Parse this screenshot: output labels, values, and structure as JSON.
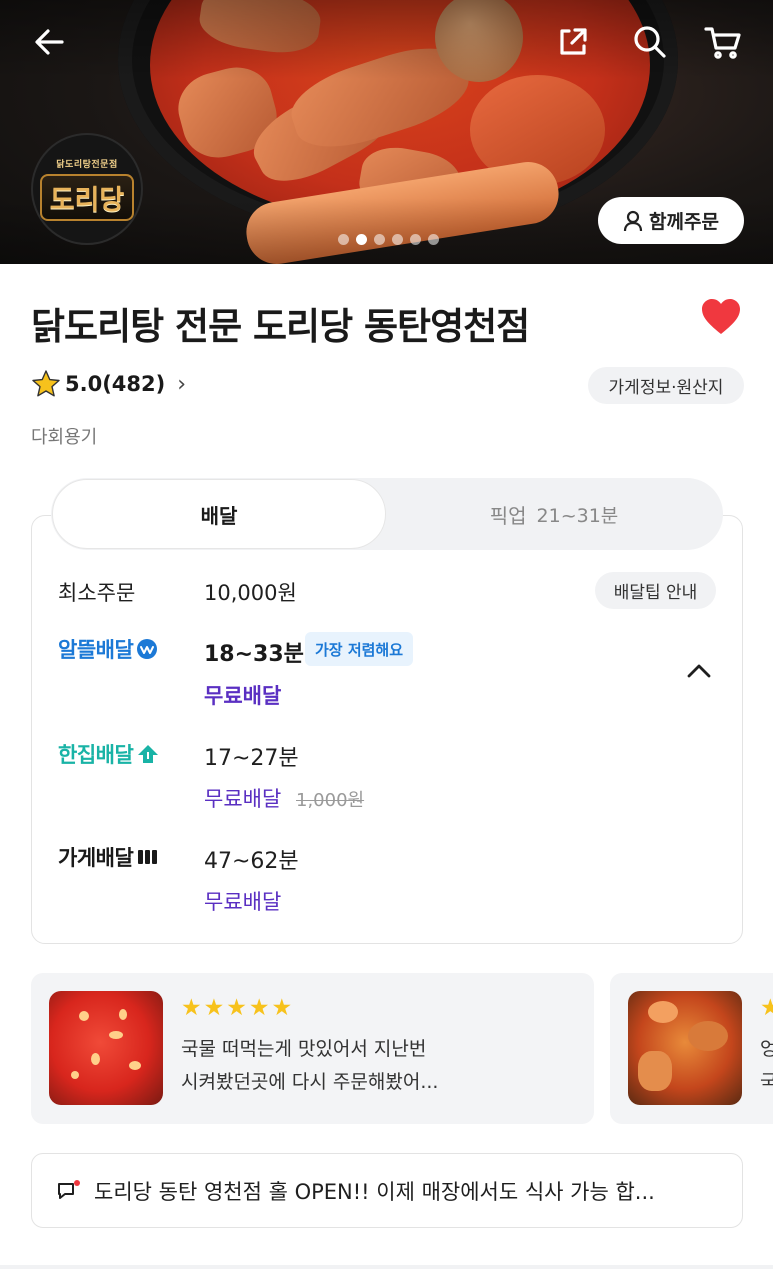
{
  "hero": {
    "logo_sub": "닭도리탕전문점",
    "logo_main": "도리당",
    "together_label": "함께주문",
    "slide_count": 6,
    "active_slide": 2
  },
  "store": {
    "title": "닭도리탕 전문 도리당 동탄영천점",
    "favorited": true,
    "rating": "5.0(482)",
    "info_chip": "가게정보·원산지",
    "reusable": "다회용기"
  },
  "tabs": {
    "delivery": "배달",
    "pickup": "픽업",
    "pickup_time": "21~31분"
  },
  "delivery": {
    "min_order_label": "최소주문",
    "min_order_value": "10,000원",
    "tip_chip": "배달팁 안내",
    "options": [
      {
        "brand": "알뜰배달",
        "time": "18~33분",
        "badge": "가장 저렴해요",
        "fee": "무료배달",
        "original_fee": ""
      },
      {
        "brand": "한집배달",
        "time": "17~27분",
        "badge": "",
        "fee": "무료배달",
        "original_fee": "1,000원"
      },
      {
        "brand": "가게배달",
        "time": "47~62분",
        "badge": "",
        "fee": "무료배달",
        "original_fee": ""
      }
    ]
  },
  "reviews": [
    {
      "stars": "★★★★★",
      "text_line1": "국물 떠먹는게 맛있어서 지난번",
      "text_line2": "시켜봤던곳에 다시 주문해봤어..."
    },
    {
      "stars": "★",
      "text_line1": "엉",
      "text_line2": "국"
    }
  ],
  "notice": {
    "text": "도리당 동탄 영천점 홀 OPEN!! 이제 매장에서도 식사 가능 합..."
  },
  "colors": {
    "accent_purple": "#5a2fc2",
    "alddeul_blue": "#1c79d6",
    "hanjip_teal": "#19b3a6",
    "heart_red": "#f0383f",
    "star_yellow": "#f7c21c"
  }
}
